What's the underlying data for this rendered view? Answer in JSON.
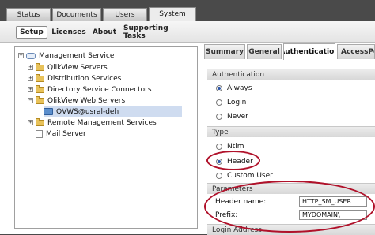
{
  "main_tabs": [
    {
      "label": "Status"
    },
    {
      "label": "Documents"
    },
    {
      "label": "Users"
    },
    {
      "label": "System",
      "active": true
    }
  ],
  "sub_tabs": [
    {
      "label": "Setup",
      "active": true
    },
    {
      "label": "Licenses"
    },
    {
      "label": "About"
    },
    {
      "label": "Supporting Tasks"
    }
  ],
  "tree": {
    "root": "Management Service",
    "items": [
      {
        "label": "QlikView Servers",
        "expander": "+"
      },
      {
        "label": "Distribution Services",
        "expander": "+"
      },
      {
        "label": "Directory Service Connectors",
        "expander": "+"
      },
      {
        "label": "QlikView Web Servers",
        "expander": "−"
      },
      {
        "label": "QVWS@usral-deh",
        "selected": true
      },
      {
        "label": "Remote Management Services",
        "expander": "+"
      },
      {
        "label": "Mail Server"
      }
    ]
  },
  "right_tabs": [
    {
      "label": "Summary"
    },
    {
      "label": "General"
    },
    {
      "label": "Authentication",
      "active": true
    },
    {
      "label": "AccessPoi"
    }
  ],
  "authentication": {
    "section_title": "Authentication",
    "options": [
      {
        "label": "Always",
        "checked": true
      },
      {
        "label": "Login",
        "checked": false
      },
      {
        "label": "Never",
        "checked": false
      }
    ]
  },
  "type": {
    "section_title": "Type",
    "options": [
      {
        "label": "Ntlm",
        "checked": false
      },
      {
        "label": "Header",
        "checked": true
      },
      {
        "label": "Custom User",
        "checked": false
      }
    ]
  },
  "parameters": {
    "section_title": "Parameters",
    "header_name_label": "Header name:",
    "header_name_value": "HTTP_SM_USER",
    "prefix_label": "Prefix:",
    "prefix_value": "MYDOMAIN\\"
  },
  "login_address": {
    "section_title": "Login Address"
  },
  "colors": {
    "highlight_ellipse": "#b0112a",
    "selection": "#cfdcf0"
  }
}
